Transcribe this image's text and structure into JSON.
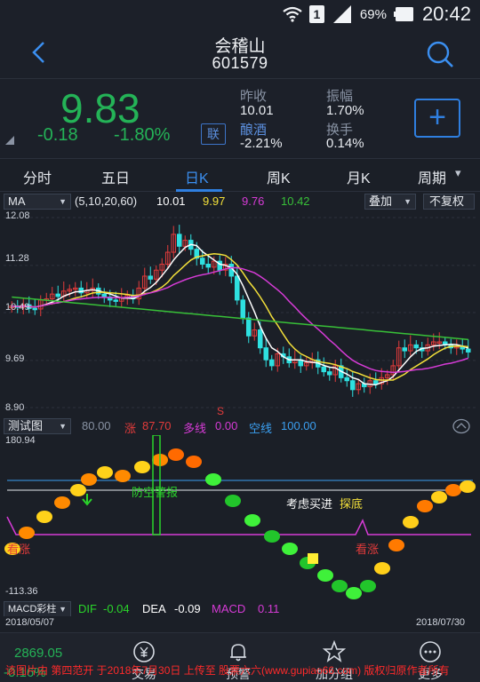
{
  "status_bar": {
    "battery": "69%",
    "time": "20:42",
    "sim": "1"
  },
  "header": {
    "stock_name": "会稽山",
    "stock_code": "601579"
  },
  "quote": {
    "price": "9.83",
    "change": "-0.18",
    "change_pct": "-1.80%",
    "link_label": "联",
    "prev_close_label": "昨收",
    "prev_close": "10.01",
    "amplitude_label": "振幅",
    "amplitude": "1.70%",
    "sector_label": "酿酒",
    "sector_change": "-2.21%",
    "turnover_label": "换手",
    "turnover": "0.14%",
    "add_label": "+"
  },
  "tabs": [
    {
      "label": "分时",
      "active": false
    },
    {
      "label": "五日",
      "active": false
    },
    {
      "label": "日K",
      "active": true
    },
    {
      "label": "周K",
      "active": false
    },
    {
      "label": "月K",
      "active": false
    },
    {
      "label": "周期",
      "active": false
    }
  ],
  "ma_bar": {
    "indicator": "MA",
    "params": "(5,10,20,60)",
    "ma5": "10.01",
    "ma10": "9.97",
    "ma20": "9.76",
    "ma60": "10.42",
    "overlay_label": "叠加",
    "adjust_label": "不复权"
  },
  "kline": {
    "y_ticks": [
      "12.08",
      "11.28",
      "10.49",
      "9.69",
      "8.90"
    ],
    "s_marker": "S"
  },
  "test_bar": {
    "indicator": "测试图",
    "v1": "80.00",
    "up_label": "涨",
    "v2": "87.70",
    "long_label": "多线",
    "v3": "0.00",
    "short_label": "空线",
    "v4": "100.00"
  },
  "test_chart": {
    "y_max": "180.94",
    "y_min": "-113.36",
    "label_warn": "防空警报",
    "label_buy": "考虑买进",
    "label_bottom": "探底",
    "label_look_up": "看涨",
    "label_look_up_left": "看涨"
  },
  "macd_bar": {
    "indicator": "MACD彩柱",
    "dif_label": "DIF",
    "dif": "-0.04",
    "dea_label": "DEA",
    "dea": "-0.09",
    "macd_label": "MACD",
    "macd": "0.11"
  },
  "date_range": {
    "start": "2018/05/07",
    "end": "2018/07/30"
  },
  "bottom_nav": {
    "index_value": "2869.05",
    "index_pct": "-0.16%",
    "items": [
      "交易",
      "预警",
      "加分组",
      "更多"
    ]
  },
  "copyright": "该图片由 第四范开 于2018年7月30日 上传至 股票六六(www.gupiao66.com) 版权归原作者所有",
  "colors": {
    "down": "#24b357",
    "up": "#e23b3b",
    "accent": "#2f7fe0",
    "ma5": "#ffffff",
    "ma10": "#f3e03a",
    "ma20": "#d63bd6",
    "ma60": "#38c038"
  }
}
